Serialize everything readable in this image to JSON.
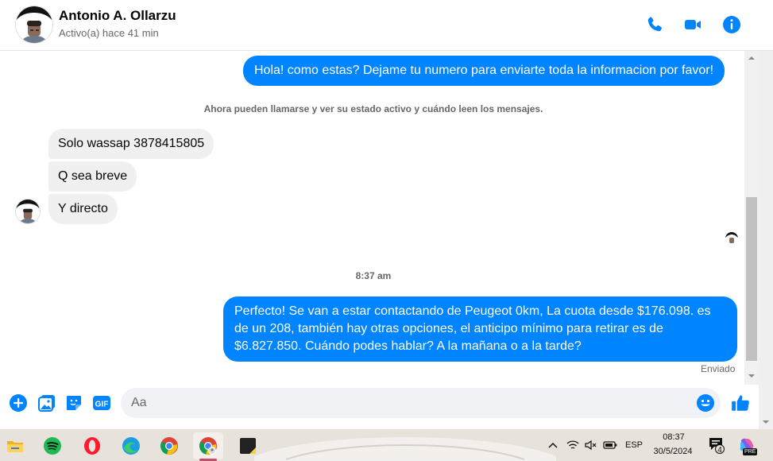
{
  "header": {
    "contact_name": "Antonio A. Ollarzu",
    "status": "Activo(a) hace 41 min",
    "icons": [
      "phone-icon",
      "video-camera-icon",
      "info-icon"
    ]
  },
  "messages": {
    "m1": "Hola! como estas? Dejame tu numero para enviarte toda la informacion por favor!",
    "notice": "Ahora pueden llamarse y ver su estado activo y cuándo leen los mensajes.",
    "m2": "Solo wassap 3878415805",
    "m3": "Q sea breve",
    "m4": "Y directo",
    "timestamp": "8:37 am",
    "m5_lines": [
      "Perfecto!  Se van a estar contactando de Peugeot 0km, La cuota desde $176.098. es",
      "de un 208, también hay otras opciones, el anticipo mínimo para retirar es de",
      "$6.827.850. Cuándo podes hablar? A la mañana o a la tarde?"
    ],
    "sent_status": "Enviado"
  },
  "composer": {
    "placeholder": "Aa",
    "icons": [
      "add-circle-icon",
      "gallery-icon",
      "sticker-icon",
      "gif-icon",
      "emoji-icon",
      "like-thumb-icon"
    ],
    "gif_label": "GIF"
  },
  "taskbar": {
    "apps": [
      "file-explorer-icon",
      "spotify-icon",
      "opera-icon",
      "edge-icon",
      "chrome-icon",
      "chrome-profile-icon",
      "sticky-notes-icon"
    ],
    "language": "ESP",
    "time": "08:37",
    "date": "30/5/2024",
    "notification_count": "4",
    "copilot_badge": "PRE"
  },
  "colors": {
    "outgoing_bubble": "#0084ff",
    "incoming_bubble": "#f0f0f0",
    "accent": "#0084ff",
    "taskbar_bg": "#e8e2dc"
  }
}
